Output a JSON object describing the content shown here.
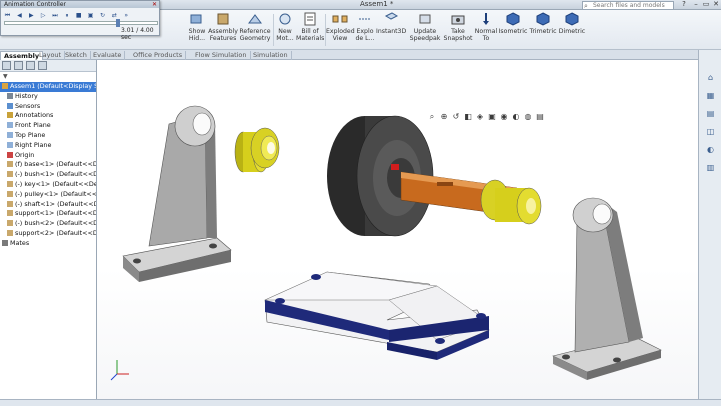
{
  "window": {
    "doc_title": "Assem1 *",
    "search_placeholder": "Search files and models"
  },
  "animation_controller": {
    "title": "Animation Controller",
    "time": "3.01 / 4.00 sec",
    "progress": 0.75
  },
  "command_manager": {
    "items": [
      {
        "label": "Show Hid...",
        "icon": "show-hide-icon"
      },
      {
        "label": "Assembly Features",
        "icon": "assembly-features-icon"
      },
      {
        "label": "Reference Geometry",
        "icon": "reference-geometry-icon"
      },
      {
        "label": "New Mot...",
        "icon": "new-motion-study-icon"
      },
      {
        "label": "Bill of Materials",
        "icon": "bill-of-materials-icon"
      },
      {
        "label": "Exploded View",
        "icon": "exploded-view-icon"
      },
      {
        "label": "Explo de L...",
        "icon": "explode-line-icon"
      },
      {
        "label": "Instant3D",
        "icon": "instant3d-icon"
      },
      {
        "label": "Update Speedpak",
        "icon": "speedpak-icon"
      },
      {
        "label": "Take Snapshot",
        "icon": "snapshot-icon"
      },
      {
        "label": "Normal To",
        "icon": "normal-to-icon"
      },
      {
        "label": "Isometric",
        "icon": "isometric-icon"
      },
      {
        "label": "Trimetric",
        "icon": "trimetric-icon"
      },
      {
        "label": "Dimetric",
        "icon": "dimetric-icon"
      }
    ]
  },
  "tabs": [
    "Assembly",
    "Layout",
    "Sketch",
    "Evaluate",
    "Office Products",
    "Flow Simulation",
    "Simulation"
  ],
  "feature_tree": {
    "filter": "▼",
    "items": [
      {
        "label": "Assem1  (Default<Display Sta",
        "icon": "assembly-icon",
        "selected": true,
        "indent": 0
      },
      {
        "label": "History",
        "icon": "history-icon",
        "selected": false,
        "indent": 1
      },
      {
        "label": "Sensors",
        "icon": "sensor-icon",
        "selected": false,
        "indent": 1
      },
      {
        "label": "Annotations",
        "icon": "annotation-icon",
        "selected": false,
        "indent": 1
      },
      {
        "label": "Front Plane",
        "icon": "plane-icon",
        "selected": false,
        "indent": 1
      },
      {
        "label": "Top Plane",
        "icon": "plane-icon",
        "selected": false,
        "indent": 1
      },
      {
        "label": "Right Plane",
        "icon": "plane-icon",
        "selected": false,
        "indent": 1
      },
      {
        "label": "Origin",
        "icon": "origin-icon",
        "selected": false,
        "indent": 1
      },
      {
        "label": "(f) base<1> (Default<<Defa",
        "icon": "part-icon",
        "selected": false,
        "indent": 1
      },
      {
        "label": "(-) bush<1> (Default<<Defa",
        "icon": "part-icon",
        "selected": false,
        "indent": 1
      },
      {
        "label": "(-) key<1> (Default<<Defa",
        "icon": "part-icon",
        "selected": false,
        "indent": 1
      },
      {
        "label": "(-) pulley<1> (Default<<De",
        "icon": "part-icon",
        "selected": false,
        "indent": 1
      },
      {
        "label": "(-) shaft<1> (Default<<Defa",
        "icon": "part-icon",
        "selected": false,
        "indent": 1
      },
      {
        "label": "support<1> (Default<<Defa",
        "icon": "part-icon",
        "selected": false,
        "indent": 1
      },
      {
        "label": "(-) bush<2> (Default<<Defa",
        "icon": "part-icon",
        "selected": false,
        "indent": 1
      },
      {
        "label": "support<2> (Default<<Defa",
        "icon": "part-icon",
        "selected": false,
        "indent": 1
      },
      {
        "label": "Mates",
        "icon": "mates-icon",
        "selected": false,
        "indent": 0
      }
    ]
  },
  "colors": {
    "selection": "#3a7bd5",
    "support_gray": "#c8c8c8",
    "bush_yellow": "#d6cf1c",
    "shaft_orange": "#c86a1e",
    "pulley_black": "#2e2e2e",
    "base_blue": "#1f2a7a"
  }
}
